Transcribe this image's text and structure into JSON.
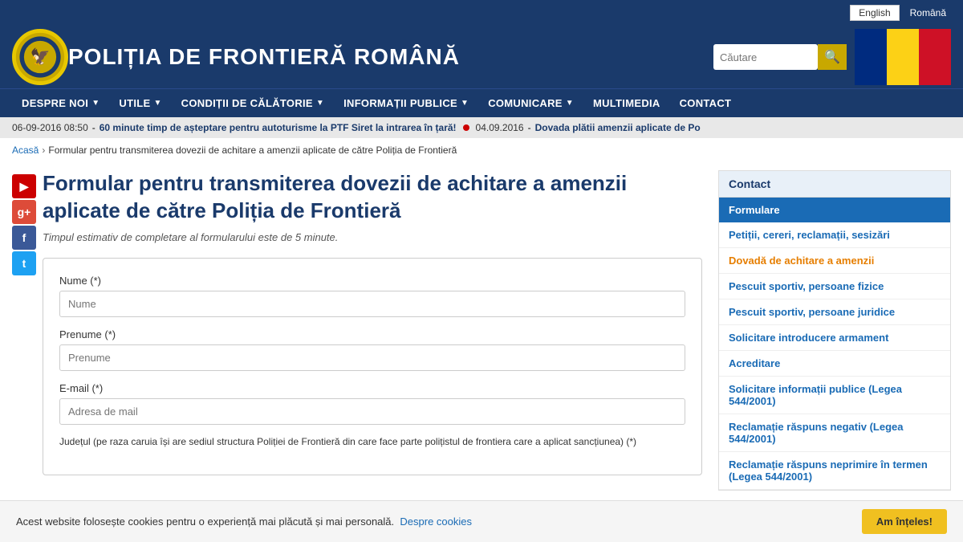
{
  "topbar": {
    "lang_en": "English",
    "lang_ro": "Română"
  },
  "header": {
    "title": "POLIȚIA DE FRONTIERĂ ROMÂNĂ",
    "search_placeholder": "Căutare",
    "logo_text": "PFR"
  },
  "nav": {
    "items": [
      {
        "label": "DESPRE NOI",
        "has_dropdown": true
      },
      {
        "label": "UTILE",
        "has_dropdown": true
      },
      {
        "label": "CONDIȚII DE CĂLĂTORIE",
        "has_dropdown": true
      },
      {
        "label": "INFORMAȚII PUBLICE",
        "has_dropdown": true
      },
      {
        "label": "COMUNICARE",
        "has_dropdown": true
      },
      {
        "label": "MULTIMEDIA",
        "has_dropdown": false
      },
      {
        "label": "CONTACT",
        "has_dropdown": false
      }
    ]
  },
  "ticker": {
    "items": [
      {
        "date": "06-09-2016 08:50",
        "text": "60 minute timp de așteptare pentru autoturisme la PTF Siret la intrarea în țară!"
      },
      {
        "date": "04.09.2016",
        "text": "Dovada plătii amenzii aplicate de Po"
      }
    ]
  },
  "breadcrumb": {
    "home": "Acasă",
    "current": "Formular pentru transmiterea dovezii de achitare a amenzii aplicate de către Poliția de Frontieră"
  },
  "page": {
    "title": "Formular pentru transmiterea dovezii de achitare a amenzii aplicate de către Poliția de Frontieră",
    "subtitle": "Timpul estimativ de completare al formularului este de 5 minute."
  },
  "form": {
    "field_nume_label": "Nume (*)",
    "field_nume_placeholder": "Nume",
    "field_prenume_label": "Prenume (*)",
    "field_prenume_placeholder": "Prenume",
    "field_email_label": "E-mail (*)",
    "field_email_placeholder": "Adresa de mail",
    "field_judet_label": "Județul (pe raza caruia își are sediul structura Poliției de Frontieră din care face parte polițistul de frontiera care a aplicat sancțiunea) (*)"
  },
  "sidebar": {
    "contact_header": "Contact",
    "formulare_header": "Formulare",
    "links": [
      {
        "label": "Petiții, cereri, reclamații, sesizări",
        "active": false
      },
      {
        "label": "Dovadă de achitare a amenzii",
        "active": true
      },
      {
        "label": "Pescuit sportiv, persoane fizice",
        "active": false
      },
      {
        "label": "Pescuit sportiv, persoane juridice",
        "active": false
      },
      {
        "label": "Solicitare introducere armament",
        "active": false
      },
      {
        "label": "Acreditare",
        "active": false
      },
      {
        "label": "Solicitare informații publice (Legea 544/2001)",
        "active": false
      },
      {
        "label": "Reclamație răspuns negativ (Legea 544/2001)",
        "active": false
      },
      {
        "label": "Reclamație răspuns neprimire în termen (Legea 544/2001)",
        "active": false
      }
    ]
  },
  "social": {
    "youtube": "▶",
    "googleplus": "g+",
    "facebook": "f",
    "twitter": "t"
  },
  "cookie": {
    "text": "Acest website folosește cookies pentru o experiență mai plăcută și mai personală.",
    "link_text": "Despre cookies",
    "button_label": "Am înțeles!"
  }
}
